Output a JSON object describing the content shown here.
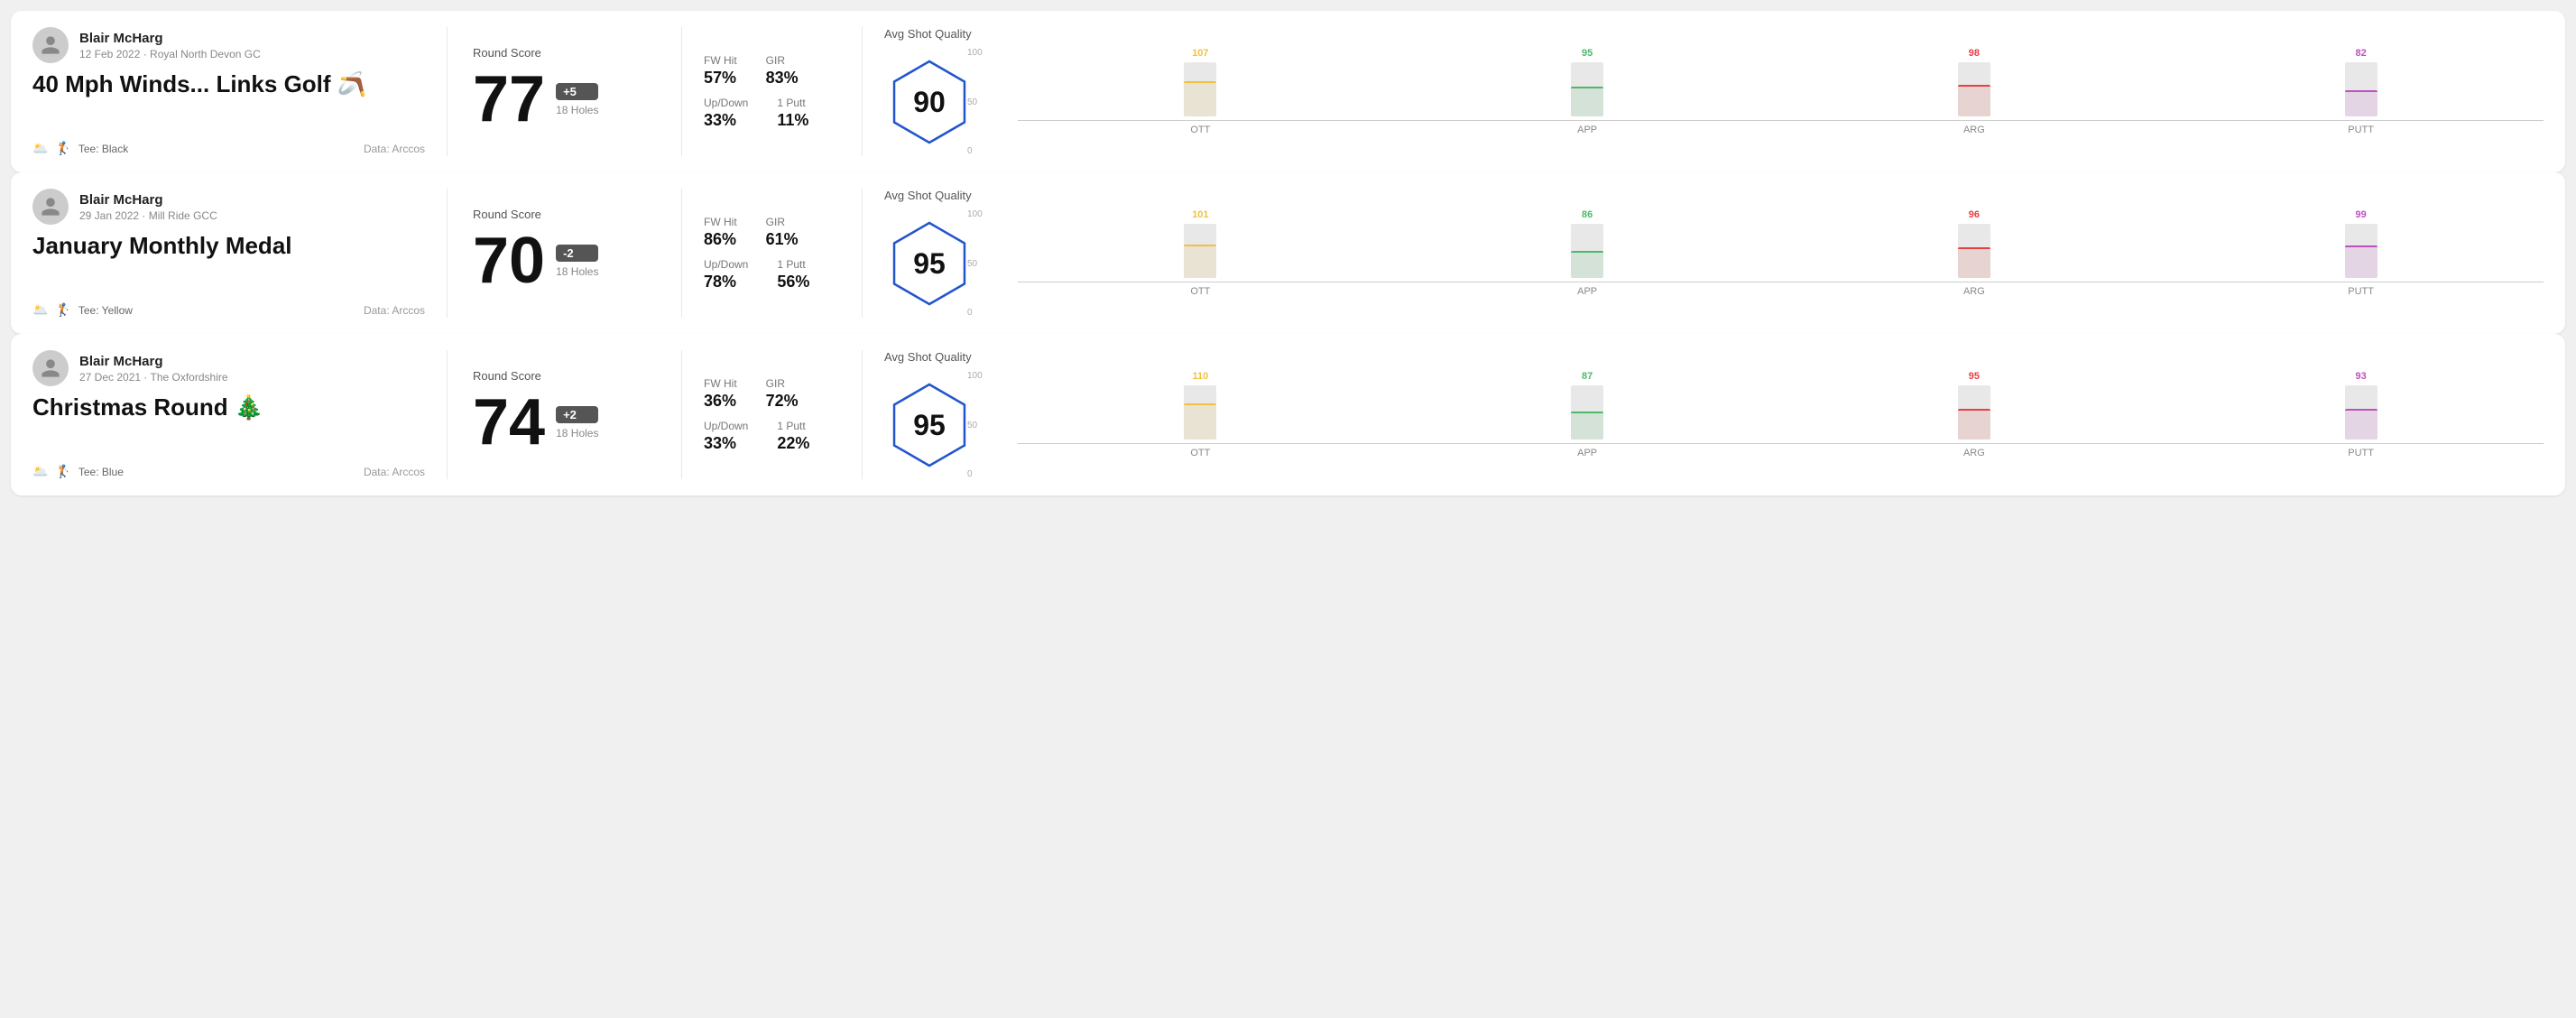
{
  "rounds": [
    {
      "id": "round-1",
      "user": {
        "name": "Blair McHarg",
        "date_course": "12 Feb 2022 · Royal North Devon GC"
      },
      "title": "40 Mph Winds... Links Golf 🪃",
      "tee": "Black",
      "data_source": "Data: Arccos",
      "round_score_label": "Round Score",
      "score": "77",
      "score_diff": "+5",
      "holes": "18 Holes",
      "fw_hit_label": "FW Hit",
      "fw_hit": "57%",
      "gir_label": "GIR",
      "gir": "83%",
      "updown_label": "Up/Down",
      "updown": "33%",
      "oneputt_label": "1 Putt",
      "oneputt": "11%",
      "avg_shot_quality_label": "Avg Shot Quality",
      "quality_score": "90",
      "chart": {
        "bars": [
          {
            "label": "OTT",
            "value": 107,
            "color": "#f0c040",
            "fill_pct": 65
          },
          {
            "label": "APP",
            "value": 95,
            "color": "#4db86a",
            "fill_pct": 55
          },
          {
            "label": "ARG",
            "value": 98,
            "color": "#e84040",
            "fill_pct": 58
          },
          {
            "label": "PUTT",
            "value": 82,
            "color": "#c050c0",
            "fill_pct": 48
          }
        ]
      }
    },
    {
      "id": "round-2",
      "user": {
        "name": "Blair McHarg",
        "date_course": "29 Jan 2022 · Mill Ride GCC"
      },
      "title": "January Monthly Medal",
      "tee": "Yellow",
      "data_source": "Data: Arccos",
      "round_score_label": "Round Score",
      "score": "70",
      "score_diff": "-2",
      "holes": "18 Holes",
      "fw_hit_label": "FW Hit",
      "fw_hit": "86%",
      "gir_label": "GIR",
      "gir": "61%",
      "updown_label": "Up/Down",
      "updown": "78%",
      "oneputt_label": "1 Putt",
      "oneputt": "56%",
      "avg_shot_quality_label": "Avg Shot Quality",
      "quality_score": "95",
      "chart": {
        "bars": [
          {
            "label": "OTT",
            "value": 101,
            "color": "#f0c040",
            "fill_pct": 62
          },
          {
            "label": "APP",
            "value": 86,
            "color": "#4db86a",
            "fill_pct": 50
          },
          {
            "label": "ARG",
            "value": 96,
            "color": "#e84040",
            "fill_pct": 57
          },
          {
            "label": "PUTT",
            "value": 99,
            "color": "#c050c0",
            "fill_pct": 60
          }
        ]
      }
    },
    {
      "id": "round-3",
      "user": {
        "name": "Blair McHarg",
        "date_course": "27 Dec 2021 · The Oxfordshire"
      },
      "title": "Christmas Round 🎄",
      "tee": "Blue",
      "data_source": "Data: Arccos",
      "round_score_label": "Round Score",
      "score": "74",
      "score_diff": "+2",
      "holes": "18 Holes",
      "fw_hit_label": "FW Hit",
      "fw_hit": "36%",
      "gir_label": "GIR",
      "gir": "72%",
      "updown_label": "Up/Down",
      "updown": "33%",
      "oneputt_label": "1 Putt",
      "oneputt": "22%",
      "avg_shot_quality_label": "Avg Shot Quality",
      "quality_score": "95",
      "chart": {
        "bars": [
          {
            "label": "OTT",
            "value": 110,
            "color": "#f0c040",
            "fill_pct": 66
          },
          {
            "label": "APP",
            "value": 87,
            "color": "#4db86a",
            "fill_pct": 51
          },
          {
            "label": "ARG",
            "value": 95,
            "color": "#e84040",
            "fill_pct": 57
          },
          {
            "label": "PUTT",
            "value": 93,
            "color": "#c050c0",
            "fill_pct": 56
          }
        ]
      }
    }
  ],
  "y_axis": {
    "top": "100",
    "mid": "50",
    "bot": "0"
  }
}
